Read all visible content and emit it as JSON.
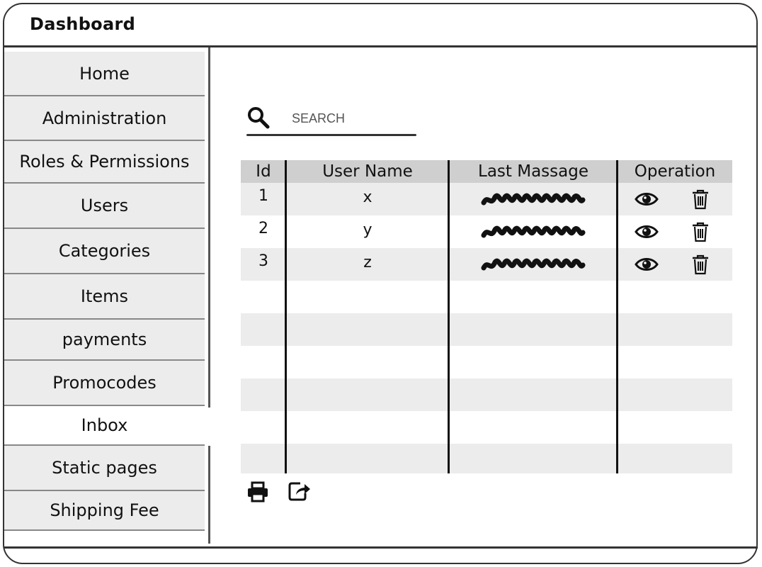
{
  "app": {
    "title": "Dashboard"
  },
  "sidebar": {
    "items": [
      {
        "label": "Home",
        "active": false
      },
      {
        "label": "Administration",
        "active": false
      },
      {
        "label": "Roles & Permissions",
        "active": false
      },
      {
        "label": "Users",
        "active": false
      },
      {
        "label": "Categories",
        "active": false
      },
      {
        "label": "Items",
        "active": false
      },
      {
        "label": "payments",
        "active": false
      },
      {
        "label": "Promocodes",
        "active": false
      },
      {
        "label": "Inbox",
        "active": true
      },
      {
        "label": "Static pages",
        "active": false
      },
      {
        "label": "Shipping Fee",
        "active": false
      }
    ]
  },
  "search": {
    "placeholder": "SEARCH",
    "value": "",
    "icon": "search-icon"
  },
  "table": {
    "headers": {
      "id": "Id",
      "user_name": "User Name",
      "last_message": "Last Massage",
      "operation": "Operation"
    },
    "rows": [
      {
        "id": "1",
        "user_name": "x",
        "last_message_redacted": true,
        "ops": [
          "view-icon",
          "trash-icon"
        ]
      },
      {
        "id": "2",
        "user_name": "y",
        "last_message_redacted": true,
        "ops": [
          "view-icon",
          "trash-icon"
        ]
      },
      {
        "id": "3",
        "user_name": "z",
        "last_message_redacted": true,
        "ops": [
          "view-icon",
          "trash-icon"
        ]
      }
    ]
  },
  "toolbar": {
    "icons": [
      "print-icon",
      "share-icon"
    ]
  },
  "colors": {
    "frame": "#333333",
    "nav_bg": "#ececec",
    "header_bg": "#cfcfcf",
    "band_bg": "#ececec"
  }
}
